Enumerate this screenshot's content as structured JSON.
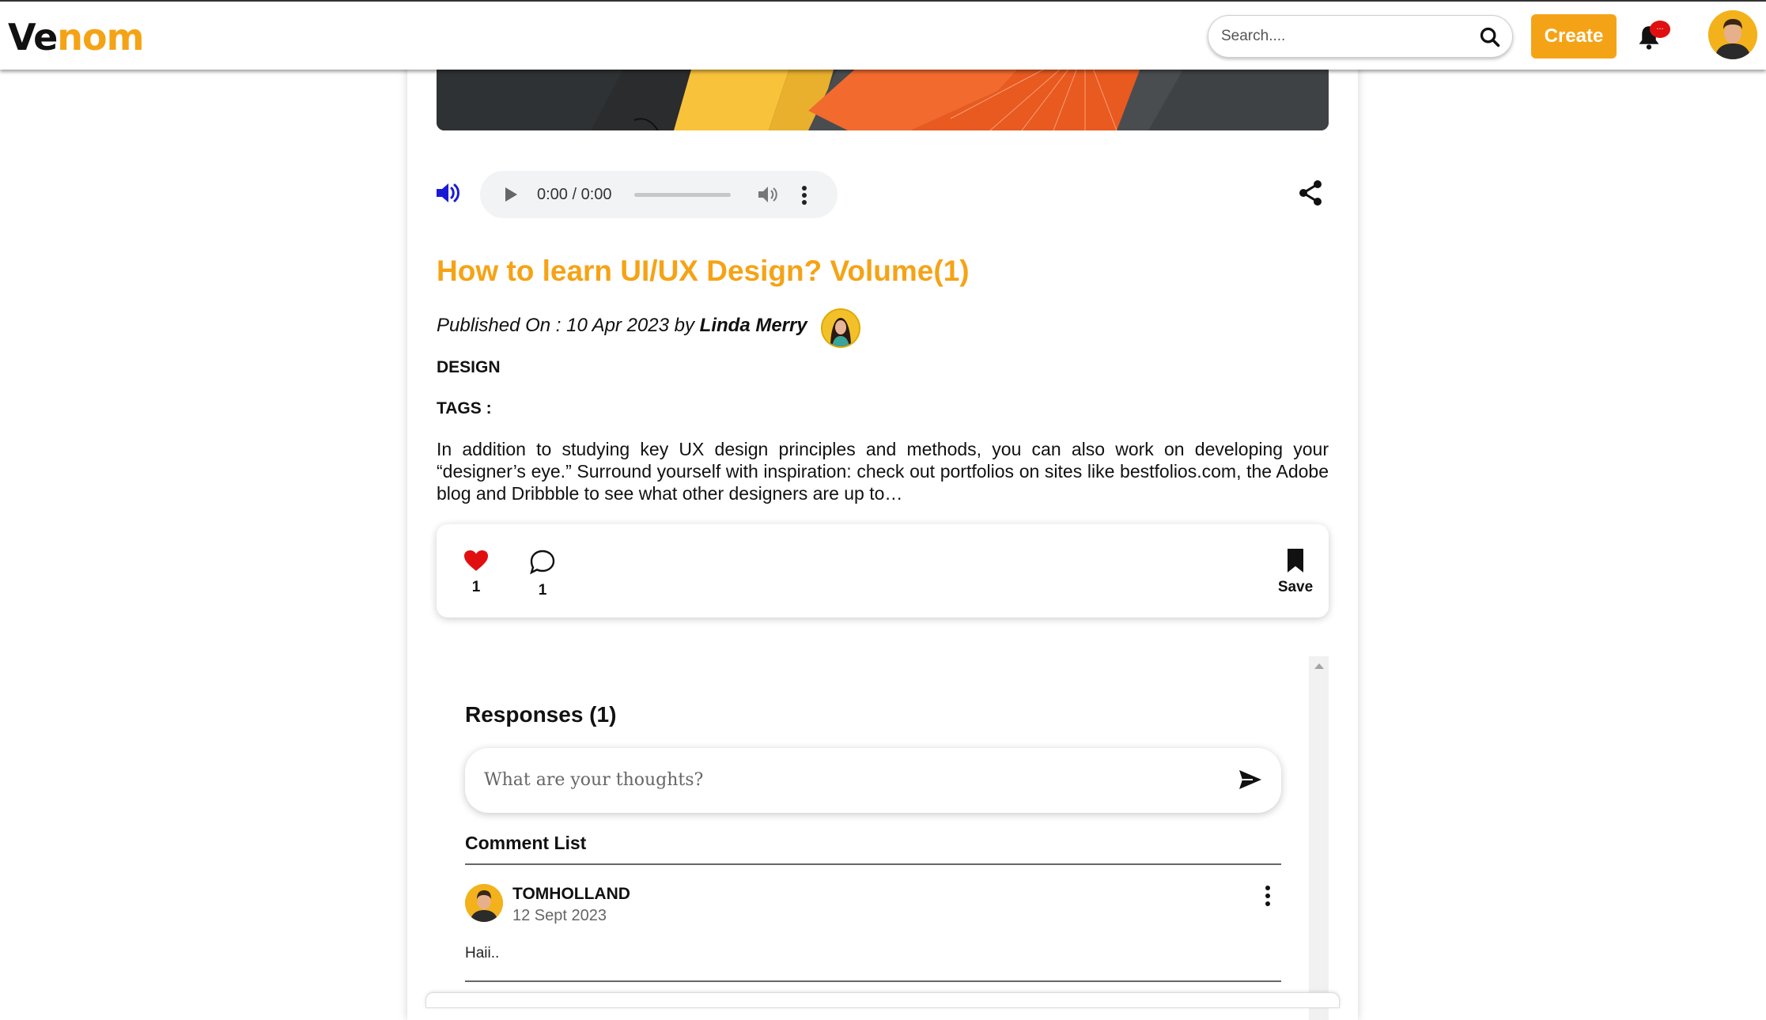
{
  "app": {
    "logo_part1": "Ve",
    "logo_part2": "nom",
    "brand_color": "#f5a316"
  },
  "header": {
    "search_placeholder": "Search....",
    "create_label": "Create",
    "notification_badge": "..."
  },
  "audio": {
    "time": "0:00 / 0:00"
  },
  "article": {
    "title": "How to learn UI/UX Design? Volume(1)",
    "published_prefix": "Published On : 10 Apr 2023 by ",
    "author": "Linda Merry",
    "category": "DESIGN",
    "tags_label": "TAGS :",
    "tags_value": "",
    "body": "In addition to studying key UX design principles and methods, you can also work on developing your “designer’s eye.” Surround yourself with inspiration: check out portfolios on sites like bestfolios.com, the Adobe blog and Dribbble to see what other designers are up to…"
  },
  "actions": {
    "likes": "1",
    "comments": "1",
    "save_label": "Save"
  },
  "responses": {
    "title": "Responses (1)",
    "input_placeholder": "What are your thoughts?",
    "list_title": "Comment List",
    "comments": [
      {
        "user": "TOMHOLLAND",
        "date": "12 Sept 2023",
        "text": "Haii.."
      }
    ]
  },
  "icons": {
    "search": "search-icon",
    "bell": "bell-icon",
    "speaker": "speaker-icon",
    "share": "share-icon",
    "heart": "heart-icon",
    "comment": "comment-icon",
    "bookmark": "bookmark-icon",
    "send": "send-icon",
    "more": "more-vertical-icon"
  },
  "colors": {
    "accent": "#f5a316",
    "like": "#e01010",
    "speaker": "#1a1ad6"
  }
}
